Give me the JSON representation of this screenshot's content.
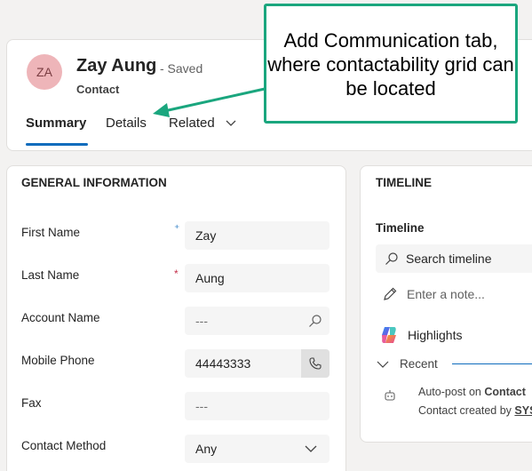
{
  "header": {
    "avatar_initials": "ZA",
    "record_name": "Zay Aung",
    "saved_status": "- Saved",
    "entity_type": "Contact",
    "tabs": [
      {
        "label": "Summary",
        "active": true
      },
      {
        "label": "Details",
        "active": false
      },
      {
        "label": "Related",
        "active": false
      }
    ]
  },
  "general_information": {
    "title": "GENERAL INFORMATION",
    "fields": [
      {
        "label": "First Name",
        "value": "Zay",
        "required": "recommended"
      },
      {
        "label": "Last Name",
        "value": "Aung",
        "required": "required"
      },
      {
        "label": "Account Name",
        "value": "---",
        "icon": "search-icon"
      },
      {
        "label": "Mobile Phone",
        "value": "44443333",
        "icon": "phone-icon"
      },
      {
        "label": "Fax",
        "value": "---"
      },
      {
        "label": "Contact Method",
        "value": "Any",
        "icon": "chevron-down-icon"
      }
    ]
  },
  "timeline": {
    "title": "TIMELINE",
    "subtitle": "Timeline",
    "search_placeholder": "Search timeline",
    "note_placeholder": "Enter a note...",
    "highlights_label": "Highlights",
    "recent_label": "Recent",
    "autopost_line1_prefix": "Auto-post on ",
    "autopost_line1_bold": "Contact",
    "autopost_line2_prefix": "Contact created by ",
    "autopost_line2_link": "SYS"
  },
  "callout": {
    "text": "Add Communication tab, where contactability grid can be located",
    "border_color": "#1aa67e"
  },
  "colors": {
    "accent": "#0f6cbd",
    "required": "#c4314b",
    "avatar_bg": "#eeb5b9"
  }
}
